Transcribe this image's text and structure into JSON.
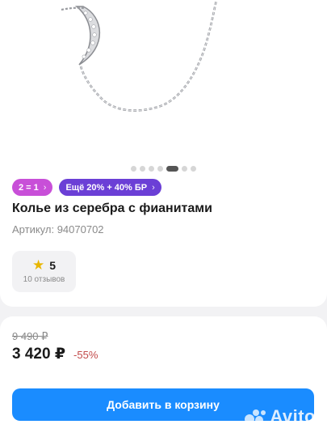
{
  "gallery": {
    "image_alt": "Колье из серебра с фианитами",
    "dots_count": 7,
    "active_dot": 5
  },
  "badges": [
    {
      "label": "2 = 1",
      "color": "#c84fd8"
    },
    {
      "label": "Ещё 20% + 40% БР",
      "color": "#6b3fd6"
    }
  ],
  "product": {
    "title": "Колье из серебра с фианитами",
    "sku_label": "Артикул: 94070702"
  },
  "rating": {
    "score": "5",
    "reviews": "10 отзывов"
  },
  "price": {
    "old": "9 490 ₽",
    "current": "3 420 ₽",
    "discount": "-55%"
  },
  "actions": {
    "add_to_cart": "Добавить в корзину"
  },
  "watermark": {
    "text": "Avito"
  },
  "colors": {
    "accent": "#1a8cff",
    "star": "#e8b600",
    "discount": "#c24a4a"
  }
}
